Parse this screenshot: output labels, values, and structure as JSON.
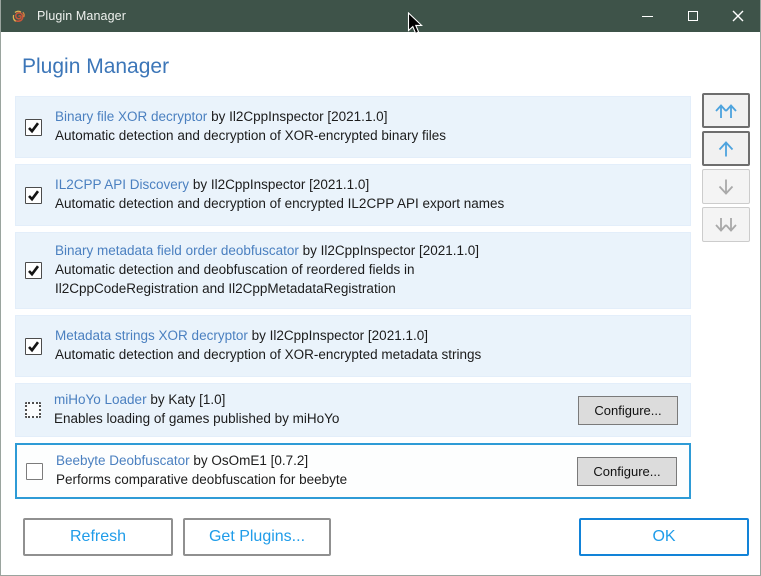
{
  "window": {
    "title": "Plugin Manager",
    "controls": [
      {
        "name": "minimize"
      },
      {
        "name": "maximize"
      },
      {
        "name": "close"
      }
    ]
  },
  "heading": "Plugin Manager",
  "labels": {
    "configure": "Configure...",
    "refresh": "Refresh",
    "get_plugins": "Get Plugins...",
    "ok": "OK"
  },
  "plugins": [
    {
      "name": "Binary file XOR decryptor",
      "byline": "by Il2CppInspector [2021.1.0]",
      "description": "Automatic detection and decryption of XOR-encrypted binary files",
      "checkbox_state": "checked",
      "has_configure": false,
      "selected": false
    },
    {
      "name": "IL2CPP API Discovery",
      "byline": "by Il2CppInspector [2021.1.0]",
      "description": "Automatic detection and decryption of encrypted IL2CPP API export names",
      "checkbox_state": "checked",
      "has_configure": false,
      "selected": false
    },
    {
      "name": "Binary metadata field order deobfuscator",
      "byline": "by Il2CppInspector [2021.1.0]",
      "description": "Automatic detection and deobfuscation of reordered fields in Il2CppCodeRegistration and Il2CppMetadataRegistration",
      "checkbox_state": "checked",
      "has_configure": false,
      "selected": false
    },
    {
      "name": "Metadata strings XOR decryptor",
      "byline": "by Il2CppInspector [2021.1.0]",
      "description": "Automatic detection and decryption of XOR-encrypted metadata strings",
      "checkbox_state": "checked",
      "has_configure": false,
      "selected": false
    },
    {
      "name": "miHoYo Loader",
      "byline": "by Katy [1.0]",
      "description": "Enables loading of games published by miHoYo",
      "checkbox_state": "dotted",
      "has_configure": true,
      "selected": false
    },
    {
      "name": "Beebyte Deobfuscator",
      "byline": "by OsOmE1 [0.7.2]",
      "description": "Performs comparative deobfuscation for beebyte",
      "checkbox_state": "unchecked",
      "has_configure": true,
      "selected": true
    }
  ],
  "move_buttons": [
    {
      "name": "move-to-top",
      "icon": "double-up-arrow",
      "enabled": true
    },
    {
      "name": "move-up",
      "icon": "up-arrow",
      "enabled": true
    },
    {
      "name": "move-down",
      "icon": "down-arrow",
      "enabled": false
    },
    {
      "name": "move-to-bottom",
      "icon": "double-down-arrow",
      "enabled": false
    }
  ],
  "colors": {
    "titlebar_bg": "#3e5349",
    "titlebar_text": "#eef1ee",
    "heading_blue": "#3c76b8",
    "link_blue": "#4b80c0",
    "row_bg": "#eaf3fb",
    "selected_border": "#2e9bd6",
    "button_text_blue": "#1f9ce9",
    "ok_border_blue": "#1283d8",
    "body_text": "#1c1c1c"
  }
}
